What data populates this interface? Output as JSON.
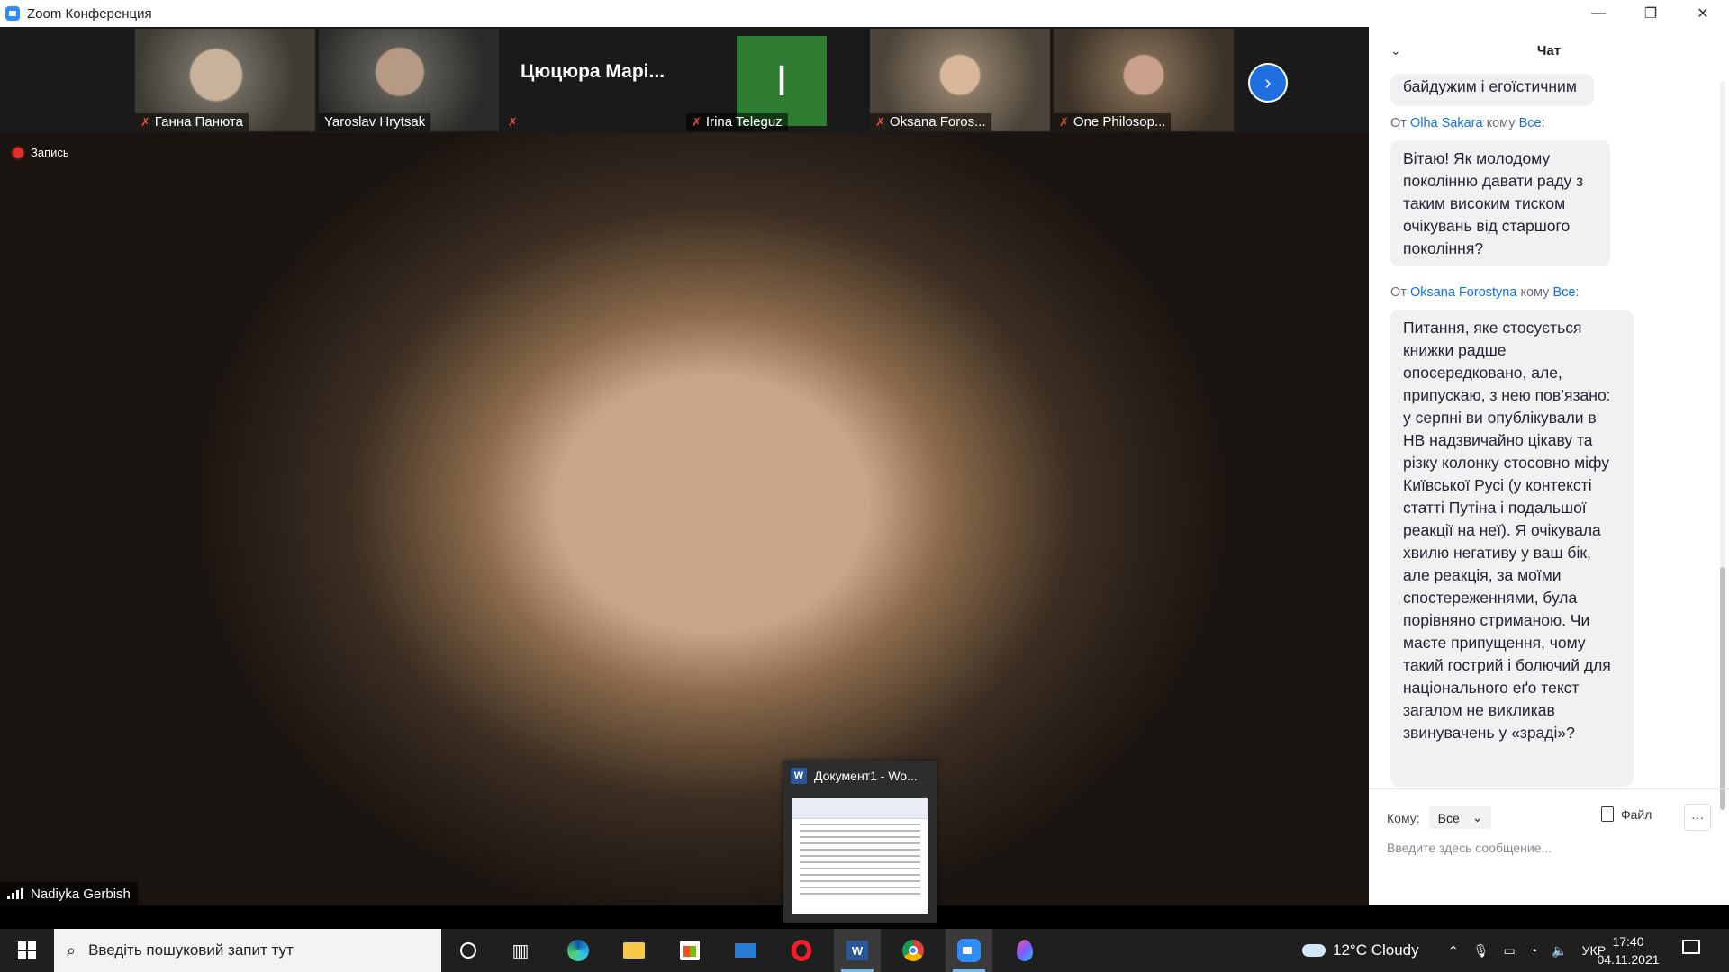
{
  "window": {
    "title": "Zoom Конференция",
    "controls": [
      "—",
      "❐",
      "✕"
    ]
  },
  "participants": [
    {
      "name": "Ганна Панюта",
      "muted": true
    },
    {
      "name": "Yaroslav Hrytsak",
      "muted": false
    },
    {
      "name": "Цюцюра Марі...",
      "muted": true
    },
    {
      "name": "Irina Teleguz",
      "muted": true,
      "avatar_letter": "I"
    },
    {
      "name": "Oksana Foros...",
      "muted": true
    },
    {
      "name": "One Philosop...",
      "muted": true
    }
  ],
  "main_video": {
    "recording_label": "Запись",
    "speaker_name": "Nadiyka Gerbish"
  },
  "word_preview": {
    "icon_letter": "W",
    "title": "Документ1 - Wo..."
  },
  "chat": {
    "title": "Чат",
    "messages": [
      {
        "text": "байдужим і егоїстичним"
      },
      {
        "from_prefix": "От",
        "sender": "Olha Sakara",
        "to_prefix": "кому",
        "recipient": "Все:",
        "text": "Вітаю! Як молодому поколінню давати раду з таким високим тиском очікувань від старшого покоління?"
      },
      {
        "from_prefix": "От",
        "sender": "Oksana Forostyna",
        "to_prefix": "кому",
        "recipient": "Все:",
        "text": "Питання, яке стосується книжки радше опосередковано, але, припускаю, з нею пов’язано: у серпні ви опублікували в НВ надзвичайно цікаву та різку колонку стосовно міфу Київської Русі (у контексті статті Путіна і подальшої реакції на неї). Я очікувала хвилю негативу у ваш бік, але реакція, за моїми спостереженнями, була порівняно стриманою. Чи маєте припущення, чому такий гострий і болючий для національного еґо текст загалом не викликав звинувачень у «зраді»?"
      }
    ],
    "to_label": "Кому:",
    "to_value": "Все",
    "file_label": "Файл",
    "more_label": "···",
    "input_placeholder": "Введите здесь сообщение..."
  },
  "taskbar": {
    "search_placeholder": "Введіть пошуковий запит тут",
    "weather": "12°C  Cloudy",
    "language": "УКР",
    "time": "17:40",
    "date": "04.11.2021"
  }
}
